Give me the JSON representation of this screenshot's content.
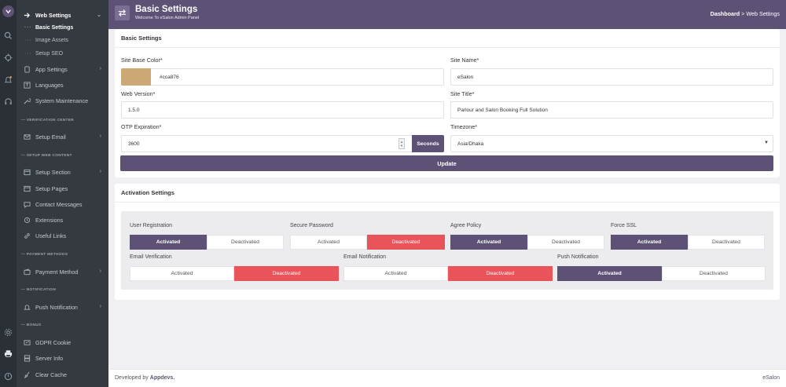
{
  "colors": {
    "brand": "#5d5276",
    "danger": "#e8545a",
    "sidebar": "#353a41",
    "rail": "#2b3037",
    "swatch": "#cca876"
  },
  "sidebar": {
    "web_settings": "Web Settings",
    "sub_items": [
      "Basic Settings",
      "Image Assets",
      "Setup SEO"
    ],
    "app_settings": "App Settings",
    "languages": "Languages",
    "system_maintenance": "System Maintenance",
    "section_verification": "— VERIFICATION CENTER",
    "setup_email": "Setup Email",
    "section_web_content": "— SETUP WEB CONTENT",
    "setup_section": "Setup Section",
    "setup_pages": "Setup Pages",
    "contact_messages": "Contact Messages",
    "extensions": "Extensions",
    "useful_links": "Useful Links",
    "section_payment": "— PAYMENT METHODS",
    "payment_method": "Payment Method",
    "section_notification": "— NOTIFICATION",
    "push_notification": "Push Notification",
    "section_bonus": "— BONUS",
    "gdpr_cookie": "GDPR Cookie",
    "server_info": "Server Info",
    "clear_cache": "Clear Cache"
  },
  "header": {
    "title": "Basic Settings",
    "subtitle": "Welcome To eSalon Admin Panel",
    "breadcrumb_home": "Dashboard",
    "breadcrumb_sep": ">",
    "breadcrumb_current": "Web Settings"
  },
  "basic": {
    "title": "Basic Settings",
    "base_color_label": "Site Base Color*",
    "base_color_value": "#cca876",
    "site_name_label": "Site Name*",
    "site_name_value": "eSalon",
    "web_version_label": "Web Version*",
    "web_version_value": "1.5.0",
    "site_title_label": "Site Title*",
    "site_title_value": "Parlour and Salon Booking Full Solution",
    "otp_label": "OTP Expiration*",
    "otp_value": "3600",
    "otp_unit": "Seconds",
    "timezone_label": "Timezone*",
    "timezone_value": "Asia/Dhaka",
    "update_label": "Update"
  },
  "activation": {
    "title": "Activation Settings",
    "activated": "Activated",
    "deactivated": "Deactivated",
    "user_registration": "User Registration",
    "secure_password": "Secure Password",
    "agree_policy": "Agree Policy",
    "force_ssl": "Force SSL",
    "email_verification": "Email Verification",
    "email_notification": "Email Notification",
    "push_notification": "Push Notification"
  },
  "footer": {
    "developed_by": "Developed by",
    "developer": "Appdevs.",
    "brand": "eSalon"
  }
}
